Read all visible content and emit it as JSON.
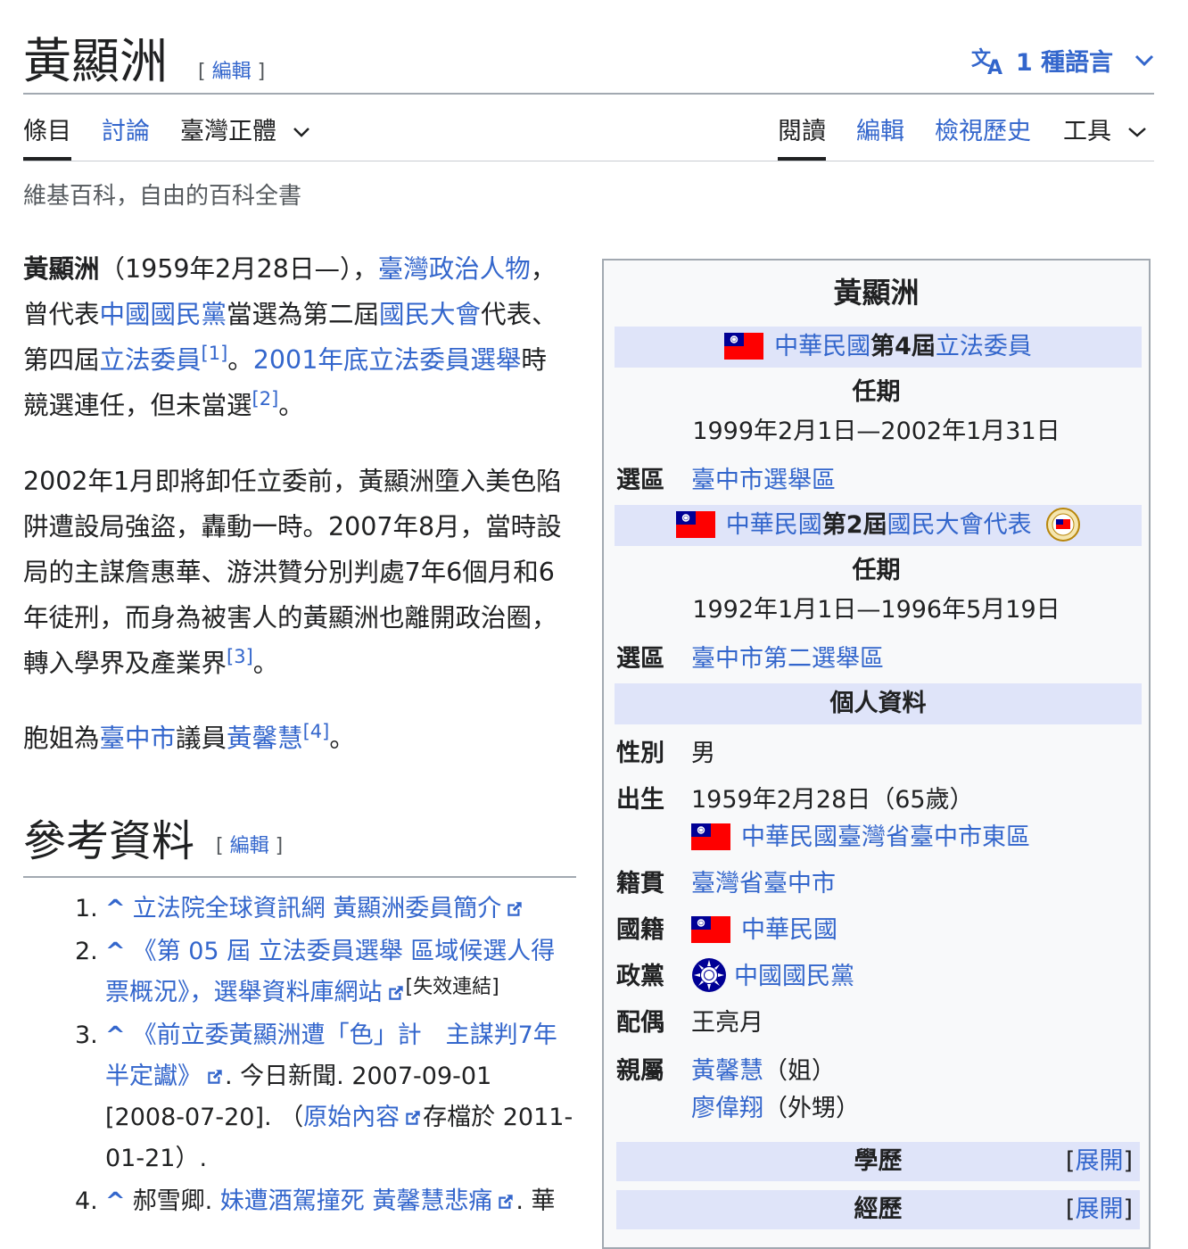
{
  "header": {
    "title": "黃顯洲",
    "edit_open": "[ ",
    "edit_label": "編輯",
    "edit_close": " ]",
    "languages": "1 種語言"
  },
  "tabs": {
    "article": "條目",
    "talk": "討論",
    "variant": "臺灣正體",
    "read": "閱讀",
    "edit": "編輯",
    "history": "檢視歷史",
    "tools": "工具"
  },
  "tagline": "維基百科，自由的百科全書",
  "body": {
    "p1": {
      "name": "黃顯洲",
      "t1": "（1959年2月28日—），",
      "l1": "臺灣政治人物",
      "t2": "，曾代表",
      "l2": "中國國民黨",
      "t3": "當選為第二屆",
      "l3": "國民大會",
      "t4": "代表、第四屆",
      "l4": "立法委員",
      "s1": "[1]",
      "t5": "。",
      "l5": "2001年底立法委員選舉",
      "t6": "時競選連任，但未當選",
      "s2": "[2]",
      "t7": "。"
    },
    "p2": {
      "text": "2002年1月即將卸任立委前，黃顯洲墮入美色陷阱遭設局強盜，轟動一時。2007年8月，當時設局的主謀詹惠華、游洪贊分別判處7年6個月和6年徒刑，而身為被害人的黃顯洲也離開政治圈，轉入學界及產業界",
      "s3": "[3]",
      "t_end": "。"
    },
    "p3": {
      "t1": "胞姐為",
      "l1": "臺中市",
      "t2": "議員",
      "l2": "黃馨慧",
      "s4": "[4]",
      "t3": "。"
    }
  },
  "refs": {
    "title": "參考資料",
    "edit_label": "編輯",
    "caret": "^",
    "items": [
      {
        "num": "1.",
        "link": "立法院全球資訊網 黃顯洲委員簡介"
      },
      {
        "num": "2.",
        "link": "《第 05 屆 立法委員選舉 區域候選人得票概況》，選舉資料庫網站",
        "dead": "[失效連結]"
      },
      {
        "num": "3.",
        "link": "《前立委黃顯洲遭「色」計　主謀判7年半定讞》",
        "t1": ". 今日新聞. 2007-09-01 [2008-07-20]. （",
        "link2": "原始內容",
        "t2": "存檔於 2011-01-21）."
      },
      {
        "num": "4.",
        "t0": "郝雪卿. ",
        "link": "妹遭酒駕撞死 黃馨慧悲痛",
        "t1": ". 華"
      }
    ]
  },
  "infobox": {
    "title": "黃顯洲",
    "office1": {
      "l1": "中華民國",
      "t1": "第4屆",
      "l2": "立法委員"
    },
    "term_label": "任期",
    "term1": "1999年2月1日—2002年1月31日",
    "district_label": "選區",
    "district1": "臺中市選舉區",
    "office2": {
      "l1": "中華民國",
      "t1": "第2屆",
      "l2": "國民大會代表"
    },
    "term2": "1992年1月1日—1996年5月19日",
    "district2": "臺中市第二選舉區",
    "personal": "個人資料",
    "gender_label": "性別",
    "gender": "男",
    "born_label": "出生",
    "born": "1959年2月28日（65歲）",
    "birthplace": "中華民國臺灣省臺中市東區",
    "origin_label": "籍貫",
    "origin": "臺灣省臺中市",
    "nationality_label": "國籍",
    "nationality": "中華民國",
    "party_label": "政黨",
    "party": "中國國民黨",
    "spouse_label": "配偶",
    "spouse": "王亮月",
    "relatives_label": "親屬",
    "rel1": "黃馨慧",
    "rel1_note": "（姐）",
    "rel2": "廖偉翔",
    "rel2_note": "（外甥）",
    "education": "學歷",
    "career": "經歷",
    "expand_open": "[",
    "expand": "展開",
    "expand_close": "]"
  },
  "colors": {
    "link": "#3366cc",
    "text": "#202122",
    "band": "#dfe4f9",
    "flag_red": "#fe0000",
    "flag_blue": "#000095"
  }
}
